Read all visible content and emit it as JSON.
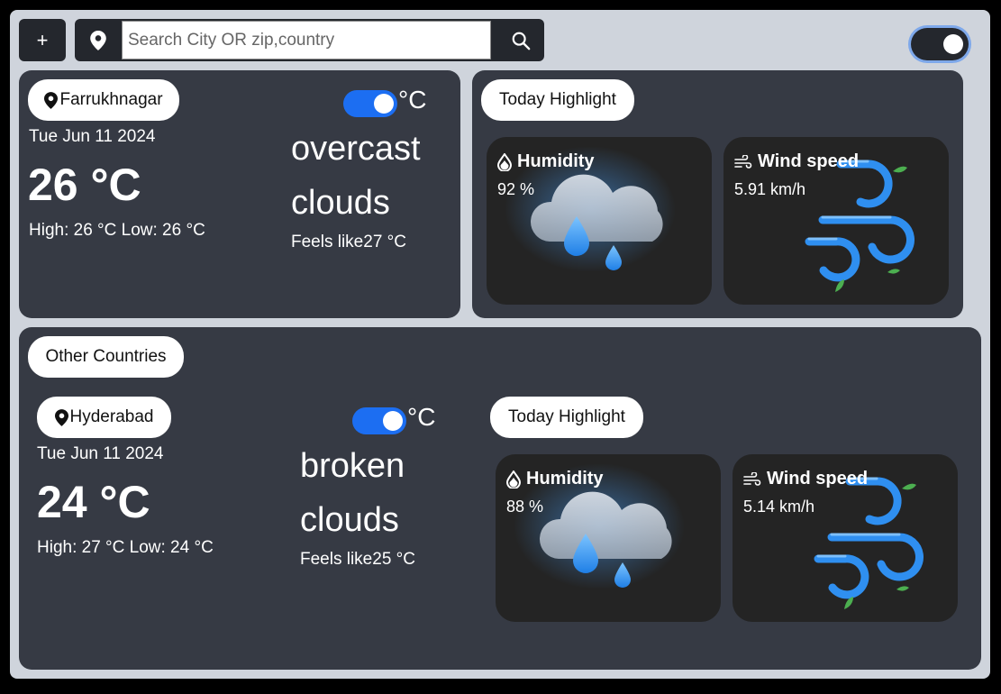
{
  "toolbar": {
    "add_label": "+",
    "search_placeholder": "Search City OR zip,country"
  },
  "current": {
    "location": "Farrukhnagar",
    "date": "Tue Jun 11 2024",
    "temp": "26 °C",
    "high_low": "High: 26 °C Low: 26 °C",
    "unit": "°C",
    "condition_line1": "overcast",
    "condition_line2": "clouds",
    "feels_like": "Feels like27 °C"
  },
  "highlight": {
    "title": "Today Highlight",
    "humidity_label": "Humidity",
    "humidity_value": "92 %",
    "wind_label": "Wind speed",
    "wind_value": "5.91 km/h"
  },
  "other": {
    "title": "Other Countries",
    "location": "Hyderabad",
    "date": "Tue Jun 11 2024",
    "temp": "24 °C",
    "high_low": "High: 27 °C Low: 24 °C",
    "unit": "°C",
    "condition_line1": "broken",
    "condition_line2": "clouds",
    "feels_like": "Feels like25 °C",
    "highlight_title": "Today Highlight",
    "humidity_label": "Humidity",
    "humidity_value": "88 %",
    "wind_label": "Wind speed",
    "wind_value": "5.14 km/h"
  },
  "colors": {
    "app_bg": "#cfd4dc",
    "card_bg": "#363a44",
    "tile_bg": "#242424",
    "toggle_accent": "#1c6ef2"
  }
}
